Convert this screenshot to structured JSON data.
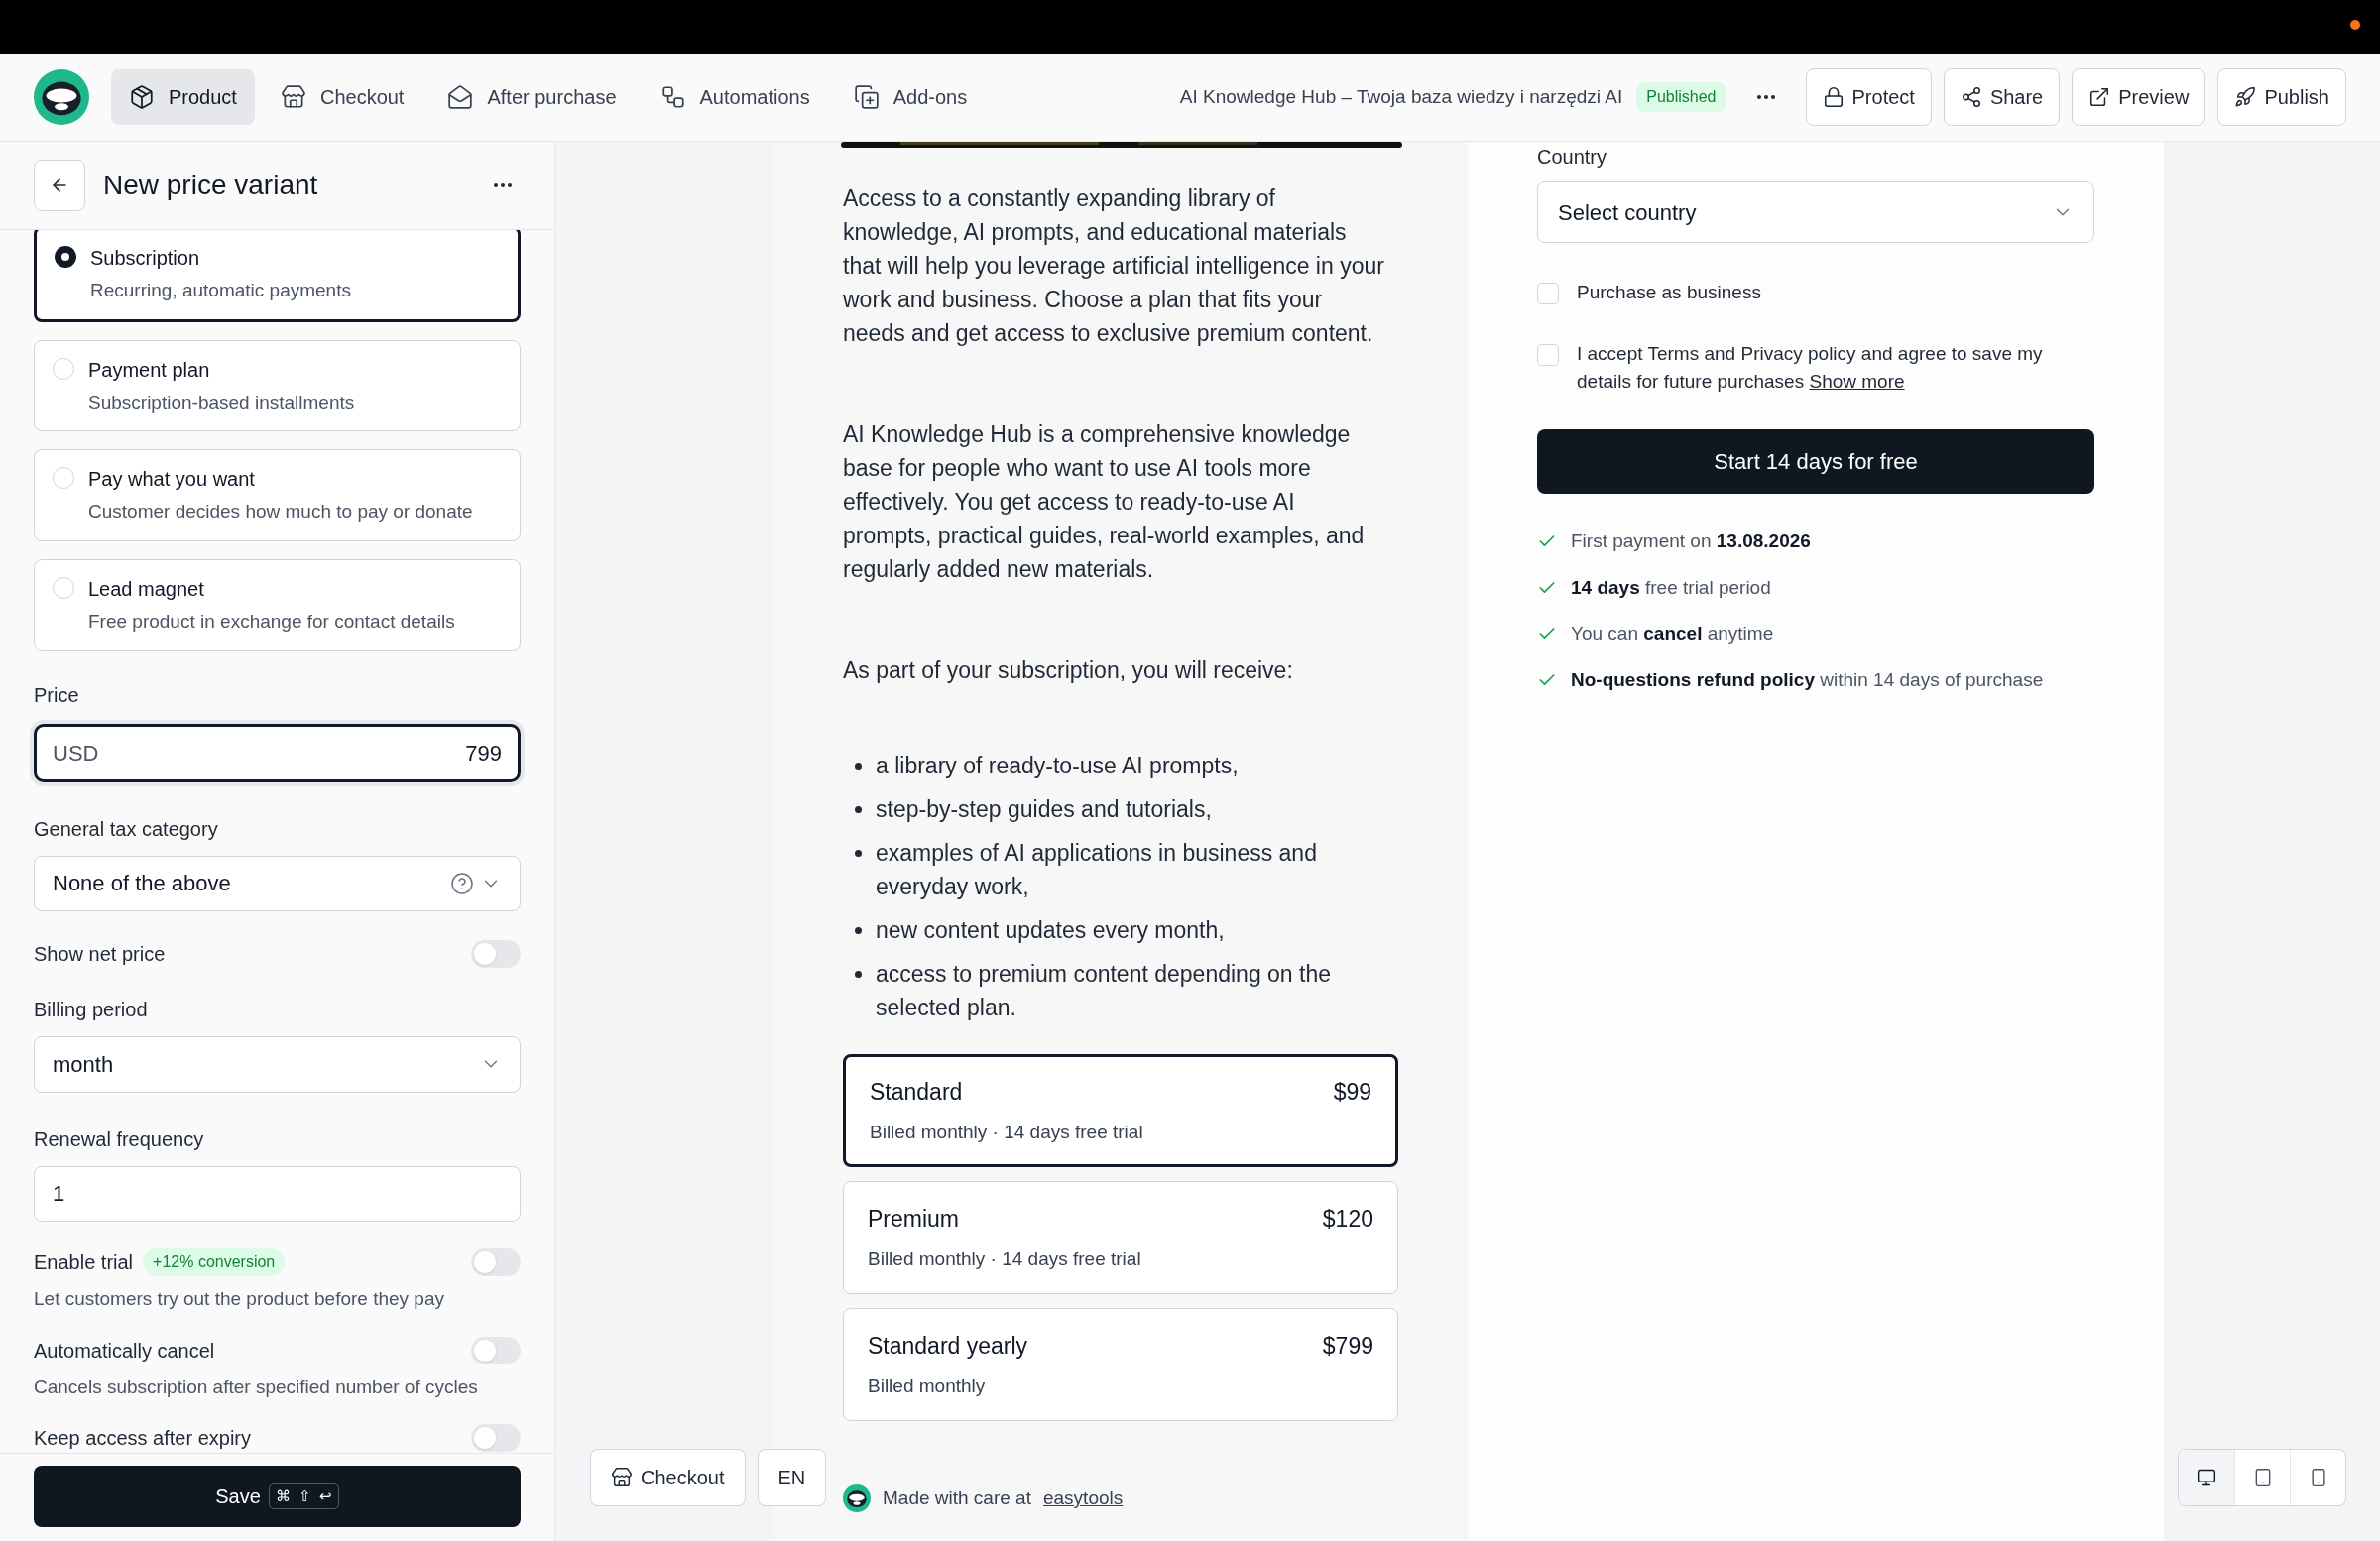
{
  "nav": {
    "tabs": [
      {
        "label": "Product",
        "selected": true
      },
      {
        "label": "Checkout",
        "selected": false
      },
      {
        "label": "After purchase",
        "selected": false
      },
      {
        "label": "Automations",
        "selected": false
      },
      {
        "label": "Add-ons",
        "selected": false
      }
    ],
    "product_title": "AI Knowledge Hub – Twoja baza wiedzy i narzędzi AI",
    "status_badge": "Published",
    "actions": [
      {
        "label": "Protect"
      },
      {
        "label": "Share"
      },
      {
        "label": "Preview"
      },
      {
        "label": "Publish"
      }
    ]
  },
  "panel": {
    "title": "New price variant",
    "price_types": [
      {
        "title": "Subscription",
        "description": "Recurring, automatic payments",
        "selected": true
      },
      {
        "title": "Payment plan",
        "description": "Subscription-based installments",
        "selected": false
      },
      {
        "title": "Pay what you want",
        "description": "Customer decides how much to pay or donate",
        "selected": false
      },
      {
        "title": "Lead magnet",
        "description": "Free product in exchange for contact details",
        "selected": false
      }
    ],
    "price": {
      "label": "Price",
      "currency": "USD",
      "value": "799"
    },
    "tax_category": {
      "label": "General tax category",
      "value": "None of the above"
    },
    "show_net_price": {
      "label": "Show net price",
      "on": false
    },
    "billing_period": {
      "label": "Billing period",
      "value": "month"
    },
    "renewal_frequency": {
      "label": "Renewal frequency",
      "value": "1"
    },
    "toggles": [
      {
        "label": "Enable trial",
        "badge": "+12% conversion",
        "description": "Let customers try out the product before they pay",
        "on": false
      },
      {
        "label": "Automatically cancel",
        "description": "Cancels subscription after specified number of cycles",
        "on": false
      },
      {
        "label": "Keep access after expiry",
        "on": false
      }
    ],
    "save_button": {
      "label": "Save",
      "shortcut": [
        "⌘",
        "⇧",
        "↩"
      ]
    }
  },
  "preview": {
    "paragraphs": [
      "Access to a constantly expanding library of knowledge, AI prompts, and educational materials that will help you leverage artificial intelligence in your work and business. Choose a plan that fits your needs and get access to exclusive premium content.",
      "AI Knowledge Hub is a comprehensive knowledge base for people who want to use AI tools more effectively. You get access to ready-to-use AI prompts, practical guides, real-world examples, and regularly added new materials.",
      "As part of your subscription, you will receive:"
    ],
    "bullets": [
      "a library of ready-to-use AI prompts,",
      "step-by-step guides and tutorials,",
      "examples of AI applications in business and everyday work,",
      "new content updates every month,",
      "access to premium content depending on the selected plan."
    ],
    "plans": [
      {
        "name": "Standard",
        "price": "$99",
        "note": "Billed monthly · 14 days free trial",
        "selected": true
      },
      {
        "name": "Premium",
        "price": "$120",
        "note": "Billed monthly · 14 days free trial",
        "selected": false
      },
      {
        "name": "Standard yearly",
        "price": "$799",
        "note": "Billed monthly",
        "selected": false
      }
    ],
    "footer": {
      "text": "Made with care at",
      "link": "easytools"
    },
    "country": {
      "label": "Country",
      "placeholder": "Select country"
    },
    "checkboxes": [
      {
        "label": "Purchase as business",
        "checked": false
      },
      {
        "label": "I accept Terms and Privacy policy and agree to save my details for future purchases",
        "link": "Show more",
        "checked": false
      }
    ],
    "cta": "Start 14 days for free",
    "benefits": [
      "First payment on **13.08.2026**",
      "**14 days** free trial period",
      "You can **cancel** anytime",
      "**No-questions refund policy** within 14 days of purchase"
    ]
  },
  "bottom_controls": {
    "buttons": [
      {
        "label": "Checkout"
      },
      {
        "label": "EN"
      }
    ],
    "devices": [
      {
        "selected": true
      },
      {
        "selected": false
      },
      {
        "selected": false
      }
    ]
  }
}
